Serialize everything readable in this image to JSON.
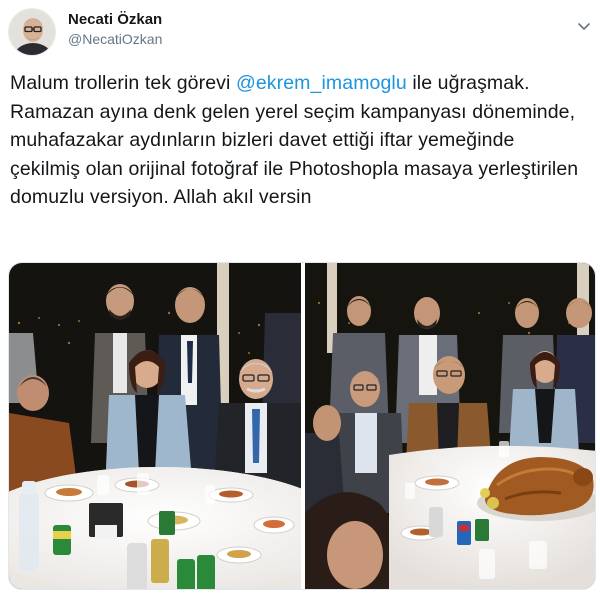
{
  "author": {
    "display_name": "Necati Özkan",
    "handle": "@NecatiOzkan"
  },
  "tweet": {
    "text_before": "Malum trollerin tek görevi ",
    "mention": "@ekrem_imamoglu",
    "text_after": " ile uğraşmak. Ramazan ayına denk gelen yerel seçim kampanyası döneminde, muhafazakar aydınların bizleri davet ettiği iftar yemeğinde çekilmiş olan orijinal fotoğraf ile Photoshopla masaya yerleştirilen domuzlu versiyon. Allah akıl versin"
  },
  "icons": {
    "more": "chevron-down-icon"
  },
  "colors": {
    "link": "#1b95e0",
    "secondary_text": "#657786",
    "primary_text": "#14171a"
  }
}
